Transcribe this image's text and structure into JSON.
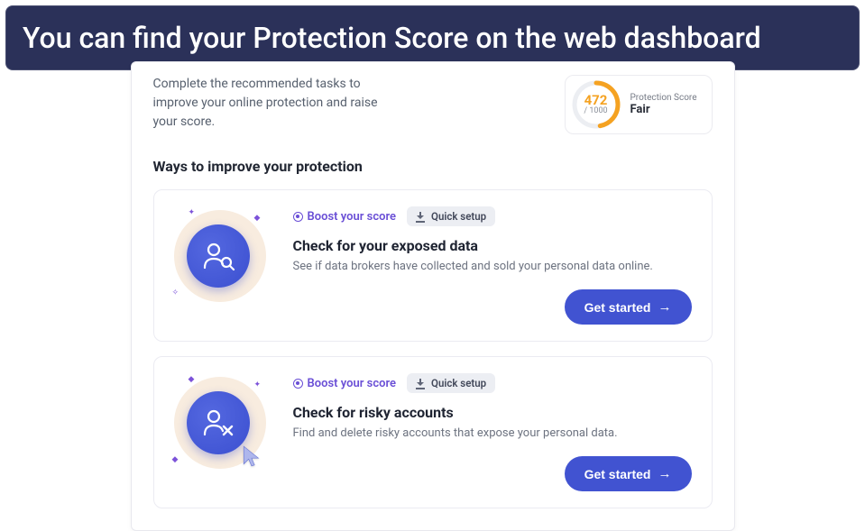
{
  "banner": {
    "text": "You can find your Protection Score on the web dashboard"
  },
  "intro": {
    "text": "Complete the recommended tasks to improve your online protection and raise your score."
  },
  "score": {
    "value": "472",
    "max": "/ 1000",
    "title": "Protection Score",
    "rating": "Fair",
    "percent": 47,
    "ring_color": "#f5a221"
  },
  "section": {
    "heading": "Ways to improve your protection"
  },
  "cards": [
    {
      "boost_label": "Boost your score",
      "pill_label": "Quick setup",
      "title": "Check for your exposed data",
      "desc": "See if data brokers have collected and sold your personal data online.",
      "action_label": "Get started",
      "icon": "profile-search"
    },
    {
      "boost_label": "Boost your score",
      "pill_label": "Quick setup",
      "title": "Check for risky accounts",
      "desc": "Find and delete risky accounts that expose your personal data.",
      "action_label": "Get started",
      "icon": "profile-delete"
    }
  ]
}
